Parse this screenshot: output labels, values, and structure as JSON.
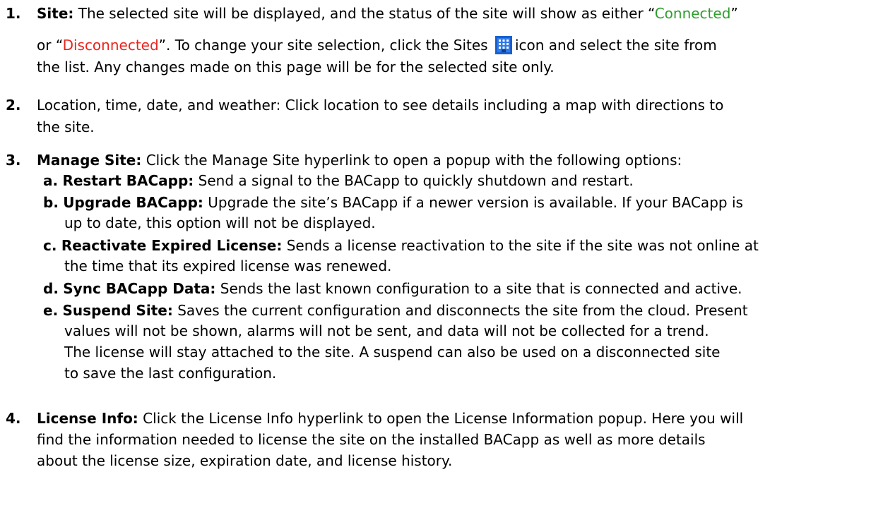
{
  "item1": {
    "number": "1.",
    "label": "Site:",
    "text_a": " The selected site will be displayed, and the status of the site will show as either “",
    "connected": "Connected",
    "text_b": "”",
    "text_c": "or “",
    "disconnected": "Disconnected",
    "text_d": "”. To change your site selection, click the Sites",
    "icon": "sites-icon",
    "text_e": "icon and select the site from",
    "text_f": "the list. Any changes made on this page will be for the selected site only."
  },
  "item2": {
    "number": "2.",
    "line1": "Location, time, date, and weather: Click location to see details including a map with directions to",
    "line2": "the site."
  },
  "item3": {
    "number": "3.",
    "label": "Manage Site:",
    "text": " Click the Manage Site hyperlink to open a popup with the following options:",
    "sub": [
      {
        "letter": "a.",
        "label": "Restart BACapp:",
        "lines": [
          " Send a signal to the BACapp to quickly shutdown and restart."
        ]
      },
      {
        "letter": "b.",
        "label": "Upgrade BACapp:",
        "lines": [
          " Upgrade the site’s BACapp if a newer version is available. If your BACapp is",
          "up to date, this option will not be displayed."
        ]
      },
      {
        "letter": "c.",
        "label": "Reactivate Expired License:",
        "lines": [
          " Sends a license reactivation to the site if the site was not online at",
          "the time that its expired license was renewed."
        ]
      },
      {
        "letter": "d.",
        "label": "Sync BACapp Data:",
        "lines": [
          " Sends the last known configuration to a site that is connected and active."
        ]
      },
      {
        "letter": "e.",
        "label": "Suspend Site:",
        "lines": [
          " Saves the current configuration and disconnects the site from the cloud. Present",
          "values will not be shown, alarms will not be sent, and data will not be collected for a trend.",
          "The license will stay attached to the site. A suspend can also be used on a disconnected site",
          "to save the last configuration."
        ]
      }
    ]
  },
  "item4": {
    "number": "4.",
    "label": "License Info:",
    "line1": " Click the License Info hyperlink to open the License Information popup. Here you will",
    "line2": "find the information needed to license the site on the installed BACapp as well as more details",
    "line3": "about the license size, expiration date, and license history."
  },
  "colors": {
    "connected": "#2e9e2e",
    "disconnected": "#e8251d",
    "icon": "#1a5fd0"
  }
}
